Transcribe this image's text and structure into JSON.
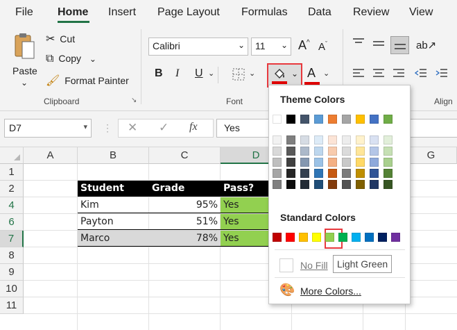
{
  "menu": {
    "tabs": [
      "File",
      "Home",
      "Insert",
      "Page Layout",
      "Formulas",
      "Data",
      "Review",
      "View"
    ],
    "active": "Home"
  },
  "clipboard": {
    "paste": "Paste",
    "cut": "Cut",
    "copy": "Copy",
    "format_painter": "Format Painter",
    "group": "Clipboard"
  },
  "font": {
    "name": "Calibri",
    "size": "11",
    "bold": "B",
    "italic": "I",
    "underline": "U",
    "font_color_letter": "A",
    "grow": "A",
    "shrink": "A",
    "group": "Font"
  },
  "alignment": {
    "group_partial": "Align"
  },
  "formula_bar": {
    "name_box": "D7",
    "fx": "fx",
    "content": "Yes"
  },
  "grid": {
    "columns": [
      "A",
      "B",
      "C",
      "D",
      "E",
      "F",
      "G"
    ],
    "rows": [
      "1",
      "2",
      "3",
      "4",
      "5",
      "6",
      "7",
      "8",
      "9",
      "10",
      "11"
    ],
    "header": [
      "Student",
      "Grade",
      "Pass?"
    ],
    "data": [
      [
        "Kim",
        "95%",
        "Yes"
      ],
      [
        "Payton",
        "51%",
        "Yes"
      ],
      [
        "Marco",
        "78%",
        "Yes"
      ]
    ]
  },
  "fill_menu": {
    "theme_title": "Theme Colors",
    "standard_title": "Standard Colors",
    "no_fill": "No Fill",
    "more_colors": "More Colors...",
    "tooltip": "Light Green",
    "theme_colors": [
      [
        "#FFFFFF",
        "#000000",
        "#44546A",
        "#5B9BD5",
        "#ED7D31",
        "#A5A5A5",
        "#FFC000",
        "#4472C4",
        "#70AD47"
      ],
      [
        "#F2F2F2",
        "#7F7F7F",
        "#D6DCE4",
        "#DDEBF7",
        "#FCE4D6",
        "#EDEDED",
        "#FFF2CC",
        "#D9E1F2",
        "#E2EFDA"
      ],
      [
        "#D9D9D9",
        "#595959",
        "#ACB9CA",
        "#BDD7EE",
        "#F8CBAD",
        "#DBDBDB",
        "#FFE699",
        "#B4C6E7",
        "#C6E0B4"
      ],
      [
        "#BFBFBF",
        "#404040",
        "#8497B0",
        "#9BC2E6",
        "#F4B084",
        "#C9C9C9",
        "#FFD966",
        "#8EA9DB",
        "#A9D08E"
      ],
      [
        "#A6A6A6",
        "#262626",
        "#333F4F",
        "#2F75B5",
        "#C65911",
        "#7B7B7B",
        "#BF8F00",
        "#305496",
        "#548235"
      ],
      [
        "#808080",
        "#0D0D0D",
        "#222B35",
        "#1F4E78",
        "#833C0C",
        "#525252",
        "#806000",
        "#203764",
        "#375623"
      ]
    ],
    "standard_colors": [
      "#C00000",
      "#FF0000",
      "#FFC000",
      "#FFFF00",
      "#92D050",
      "#00B050",
      "#00B0F0",
      "#0070C0",
      "#002060",
      "#7030A0"
    ]
  },
  "colors": {
    "accent_red": "#E00000",
    "highlight_border": "#E8383D",
    "fill_green": "#92D050",
    "header_black": "#000000"
  }
}
